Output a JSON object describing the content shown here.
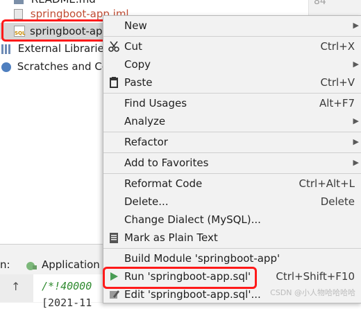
{
  "tree": {
    "partial_top": "README.md",
    "iml": "springboot-app.iml",
    "selected": "springboot-app",
    "external": "External Libraries",
    "scratches": "Scratches and Cor"
  },
  "editor": {
    "line_number": "84"
  },
  "bottom": {
    "tab_prefix": "n:",
    "app_tab": "Application",
    "console_line1": "/*!40000",
    "console_line2": "[2021-11"
  },
  "menu": {
    "new": "New",
    "cut": "Cut",
    "cut_sc": "Ctrl+X",
    "copy": "Copy",
    "paste": "Paste",
    "paste_sc": "Ctrl+V",
    "find_usages": "Find Usages",
    "find_usages_sc": "Alt+F7",
    "analyze": "Analyze",
    "refactor": "Refactor",
    "add_favorites": "Add to Favorites",
    "reformat": "Reformat Code",
    "reformat_sc": "Ctrl+Alt+L",
    "delete": "Delete...",
    "delete_sc": "Delete",
    "change_dialect": "Change Dialect (MySQL)...",
    "mark_plain": "Mark as Plain Text",
    "build_module": "Build Module 'springboot-app'",
    "run": "Run 'springboot-app.sql'",
    "run_sc": "Ctrl+Shift+F10",
    "edit": "Edit 'springboot-app.sql'..."
  },
  "watermark": "CSDN @小人物哈哈哈哈",
  "colors": {
    "highlight": "#ff1a1a",
    "run_green": "#499c54",
    "menu_bg": "#f2f2f2"
  }
}
